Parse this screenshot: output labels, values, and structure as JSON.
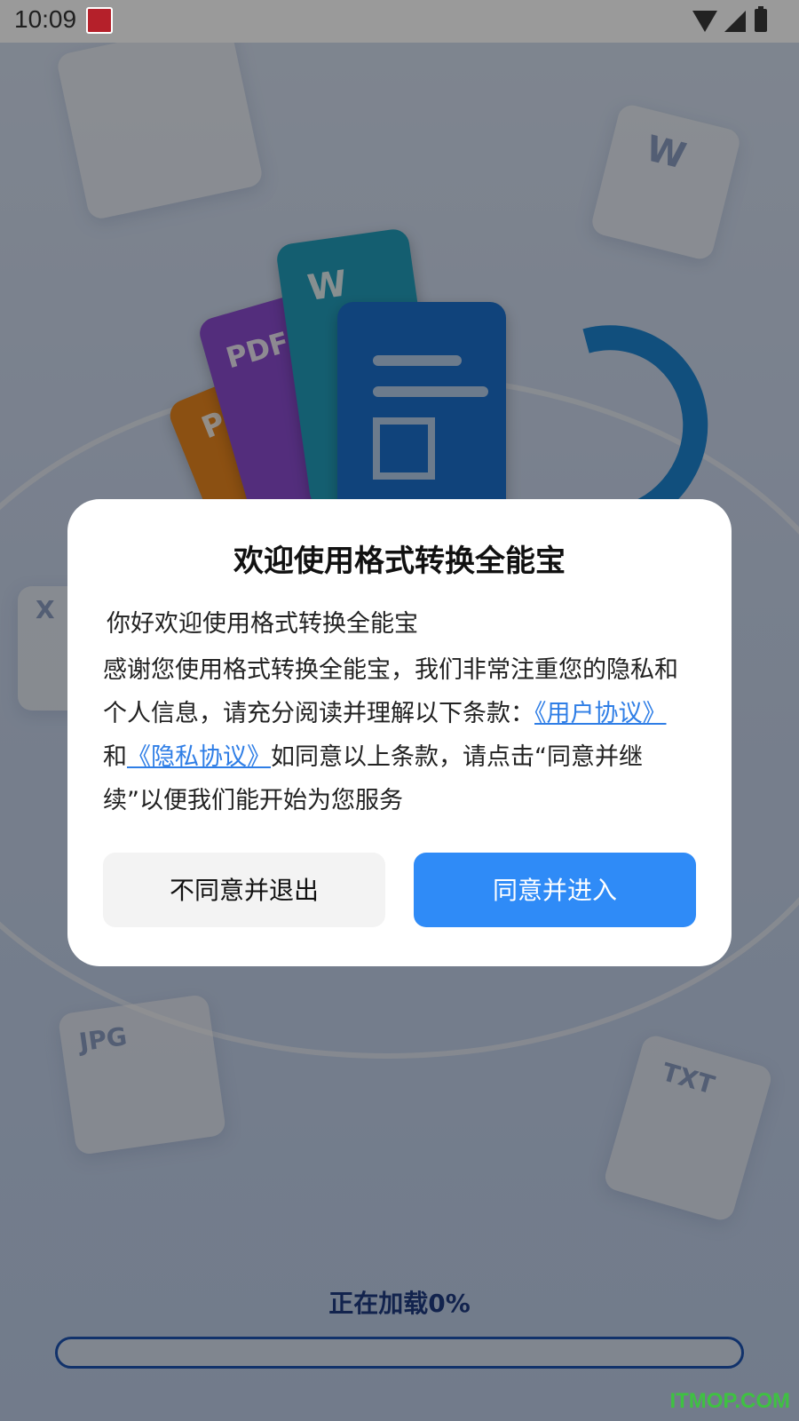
{
  "status_bar": {
    "time": "10:09",
    "icons": [
      "app-notification-icon",
      "wifi-icon",
      "signal-icon",
      "battery-icon"
    ]
  },
  "background": {
    "doc_tags": [
      "W",
      "X",
      "JPG",
      "TXT"
    ],
    "hero_cards": [
      "PDF",
      "P",
      "W"
    ]
  },
  "dialog": {
    "title": "欢迎使用格式转换全能宝",
    "greeting": "你好欢迎使用格式转换全能宝",
    "body_intro": "感谢您使用格式转换全能宝，我们非常注重您的隐私和个人信息，请充分阅读并理解以下条款：",
    "user_agreement_link": "《用户协议》",
    "and_text": "和",
    "privacy_link": "《隐私协议》",
    "body_outro": "如同意以上条款，请点击“同意并继续”以便我们能开始为您服务",
    "decline_button": "不同意并退出",
    "accept_button": "同意并进入"
  },
  "loading": {
    "text": "正在加载0%",
    "progress": 0
  },
  "watermark": "ITMOP.COM",
  "colors": {
    "accent": "#2f8bf7",
    "link": "#2f7ee6",
    "loading_text": "#1f3d86"
  }
}
